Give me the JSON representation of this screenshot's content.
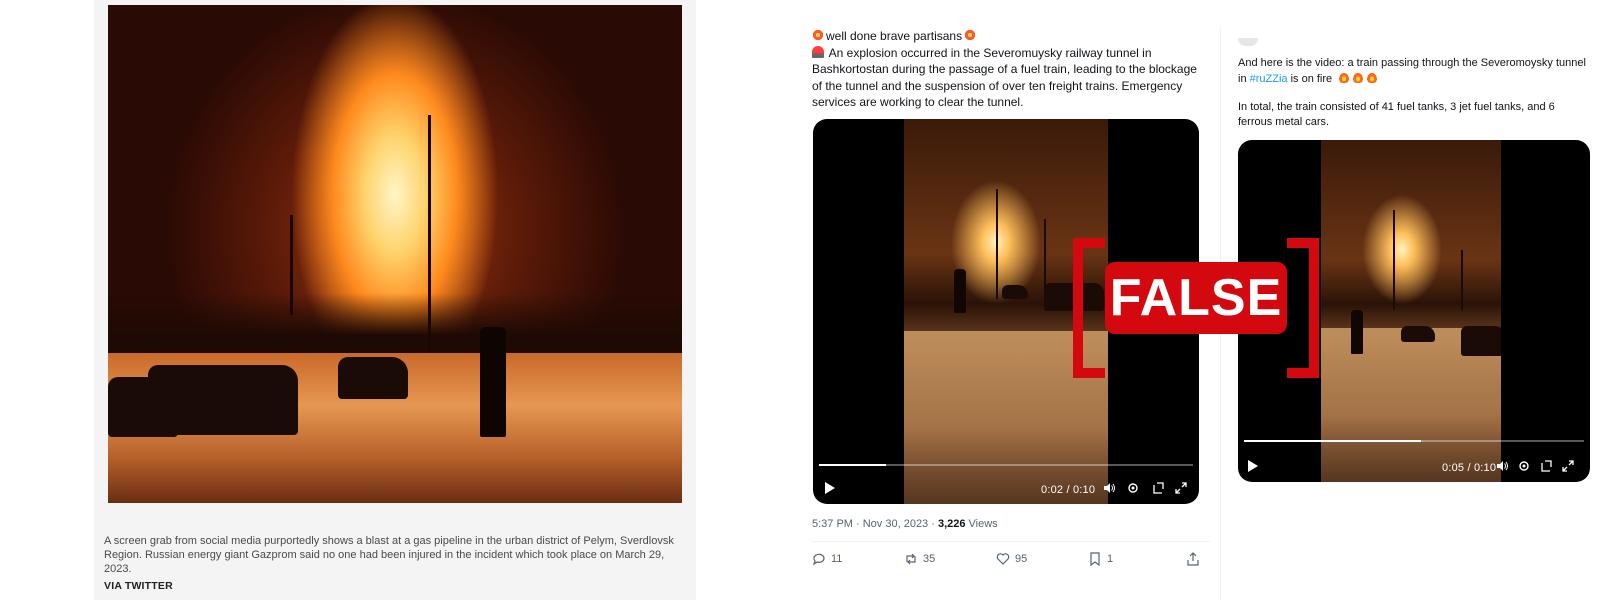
{
  "news": {
    "caption": "A screen grab from social media purportedly shows a blast at a gas pipeline in the urban district of Pelym, Sverdlovsk Region. Russian energy giant Gazprom said no one had been injured in the incident which took place on March 29, 2023.",
    "credit": "VIA TWITTER"
  },
  "tweet1": {
    "line1": "well done brave partisans",
    "body": "An explosion occurred in the Severomuysky railway tunnel in Bashkortostan during the passage of a fuel train, leading to the blockage of the tunnel and the suspension of over ten freight trains. Emergency services are working to clear the tunnel.",
    "video": {
      "time": "0:02 / 0:10",
      "progress": 0.18
    },
    "meta": {
      "timestamp": "5:37 PM · Nov 30, 2023 · ",
      "views_count": "3,226",
      "views_label": " Views"
    },
    "actions": {
      "replies": "11",
      "reposts": "35",
      "likes": "95",
      "bookmarks": "1"
    }
  },
  "tweet2": {
    "text_part1": "And here is the video: a train passing through the Severomoysky tunnel in ",
    "hashtag": "#ruZZia",
    "text_part2": " is on fire",
    "text_para2": "In total, the train consisted of 41 fuel tanks, 3 jet fuel tanks, and 6 ferrous metal cars.",
    "video": {
      "time": "0:05 / 0:10",
      "progress": 0.52
    }
  },
  "stamp": {
    "label": "FALSE",
    "color": "#d4090f"
  }
}
